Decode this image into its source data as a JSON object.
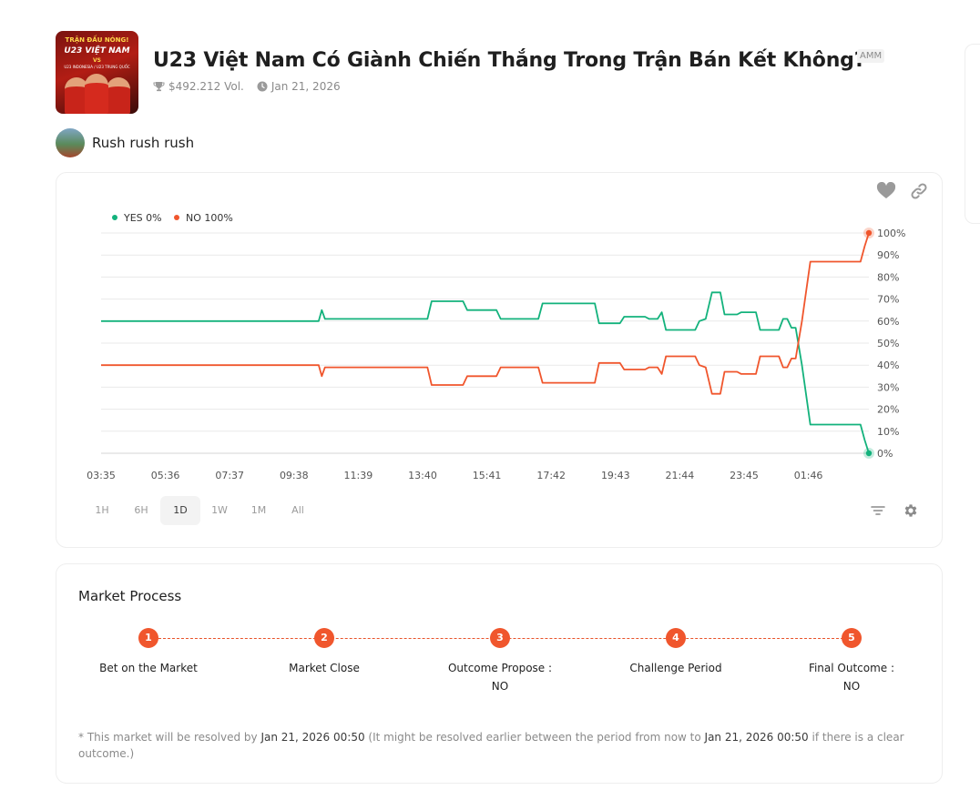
{
  "market": {
    "thumbnail": {
      "line1": "TRẬN ĐẤU NÓNG!",
      "line2": "U23 VIỆT NAM",
      "line3": "VS",
      "line4": "U23 INDONESIA / U23 TRUNG QUỐC"
    },
    "title": "U23 Việt Nam Có Giành Chiến Thắng Trong Trận Bán Kết Không?",
    "badge": "AMM",
    "volume": "$492.212 Vol.",
    "date": "Jan 21, 2026",
    "creator": "Rush rush rush"
  },
  "icons": {
    "volume": "trophy-icon",
    "date": "clock-icon",
    "like": "heart-icon",
    "share": "link-icon",
    "filter": "filter-icon",
    "settings": "gear-icon"
  },
  "colors": {
    "yes": "#13b27c",
    "no": "#f0562d",
    "grid": "#e9e9e9"
  },
  "chart_data": {
    "type": "line",
    "legend_position": "top-left",
    "grid": true,
    "ylim": [
      0,
      100
    ],
    "y_ticks": [
      "0%",
      "10%",
      "20%",
      "30%",
      "40%",
      "50%",
      "60%",
      "70%",
      "80%",
      "90%",
      "100%"
    ],
    "x_ticks": [
      "03:35",
      "05:36",
      "07:37",
      "09:38",
      "11:39",
      "13:40",
      "15:41",
      "17:42",
      "19:43",
      "21:44",
      "23:45",
      "01:46"
    ],
    "x_range_hours": [
      0,
      24
    ],
    "series": [
      {
        "name": "YES 0%",
        "color": "#13b27c",
        "points": [
          [
            0,
            60
          ],
          [
            4,
            60
          ],
          [
            8,
            60
          ],
          [
            10.4,
            60
          ],
          [
            10.55,
            65
          ],
          [
            10.7,
            61
          ],
          [
            12,
            61
          ],
          [
            14,
            61
          ],
          [
            15.6,
            61
          ],
          [
            15.8,
            69
          ],
          [
            17.3,
            69
          ],
          [
            17.5,
            65
          ],
          [
            18.9,
            65
          ],
          [
            19.1,
            61
          ],
          [
            20.9,
            61
          ],
          [
            21.1,
            68
          ],
          [
            23.6,
            68
          ],
          [
            23.8,
            59
          ],
          [
            24.8,
            59
          ],
          [
            25.0,
            62
          ],
          [
            26.0,
            62
          ],
          [
            26.2,
            61
          ],
          [
            26.6,
            61
          ],
          [
            26.8,
            64
          ],
          [
            27.0,
            56
          ],
          [
            28.4,
            56
          ],
          [
            28.6,
            60
          ],
          [
            28.9,
            61
          ],
          [
            29.2,
            73
          ],
          [
            29.6,
            73
          ],
          [
            29.8,
            63
          ],
          [
            30.4,
            63
          ],
          [
            30.6,
            64
          ],
          [
            31.3,
            64
          ],
          [
            31.5,
            56
          ],
          [
            32.4,
            56
          ],
          [
            32.6,
            61
          ],
          [
            32.8,
            61
          ],
          [
            33.0,
            57
          ],
          [
            33.2,
            57
          ],
          [
            33.5,
            40
          ],
          [
            33.9,
            13
          ],
          [
            35,
            13
          ],
          [
            36,
            13
          ],
          [
            36.3,
            13
          ],
          [
            36.5,
            6
          ],
          [
            36.7,
            0
          ]
        ]
      },
      {
        "name": "NO 100%",
        "color": "#f0562d",
        "points": [
          [
            0,
            40
          ],
          [
            4,
            40
          ],
          [
            8,
            40
          ],
          [
            10.4,
            40
          ],
          [
            10.55,
            35
          ],
          [
            10.7,
            39
          ],
          [
            12,
            39
          ],
          [
            14,
            39
          ],
          [
            15.6,
            39
          ],
          [
            15.8,
            31
          ],
          [
            17.3,
            31
          ],
          [
            17.5,
            35
          ],
          [
            18.9,
            35
          ],
          [
            19.1,
            39
          ],
          [
            20.9,
            39
          ],
          [
            21.1,
            32
          ],
          [
            23.6,
            32
          ],
          [
            23.8,
            41
          ],
          [
            24.8,
            41
          ],
          [
            25.0,
            38
          ],
          [
            26.0,
            38
          ],
          [
            26.2,
            39
          ],
          [
            26.6,
            39
          ],
          [
            26.8,
            36
          ],
          [
            27.0,
            44
          ],
          [
            28.4,
            44
          ],
          [
            28.6,
            40
          ],
          [
            28.9,
            39
          ],
          [
            29.2,
            27
          ],
          [
            29.6,
            27
          ],
          [
            29.8,
            37
          ],
          [
            30.4,
            37
          ],
          [
            30.6,
            36
          ],
          [
            31.3,
            36
          ],
          [
            31.5,
            44
          ],
          [
            32.4,
            44
          ],
          [
            32.6,
            39
          ],
          [
            32.8,
            39
          ],
          [
            33.0,
            43
          ],
          [
            33.2,
            43
          ],
          [
            33.5,
            60
          ],
          [
            33.9,
            87
          ],
          [
            35,
            87
          ],
          [
            36,
            87
          ],
          [
            36.3,
            87
          ],
          [
            36.5,
            94
          ],
          [
            36.7,
            100
          ]
        ]
      }
    ]
  },
  "range_tabs": [
    {
      "label": "1H"
    },
    {
      "label": "6H"
    },
    {
      "label": "1D",
      "active": true
    },
    {
      "label": "1W"
    },
    {
      "label": "1M"
    },
    {
      "label": "All"
    }
  ],
  "process": {
    "title": "Market Process",
    "steps": [
      {
        "num": "1",
        "label": "Bet on the Market",
        "sub": ""
      },
      {
        "num": "2",
        "label": "Market Close",
        "sub": ""
      },
      {
        "num": "3",
        "label": "Outcome Propose :",
        "sub": "NO"
      },
      {
        "num": "4",
        "label": "Challenge Period",
        "sub": ""
      },
      {
        "num": "5",
        "label": "Final Outcome :",
        "sub": "NO"
      }
    ],
    "note": {
      "part1": "* This market will be resolved by ",
      "date1": "Jan 21, 2026 00:50",
      "part2": " (It might be resolved earlier between the period from now to ",
      "date2": "Jan 21, 2026 00:50",
      "part3": " if there is a clear outcome.)"
    }
  }
}
